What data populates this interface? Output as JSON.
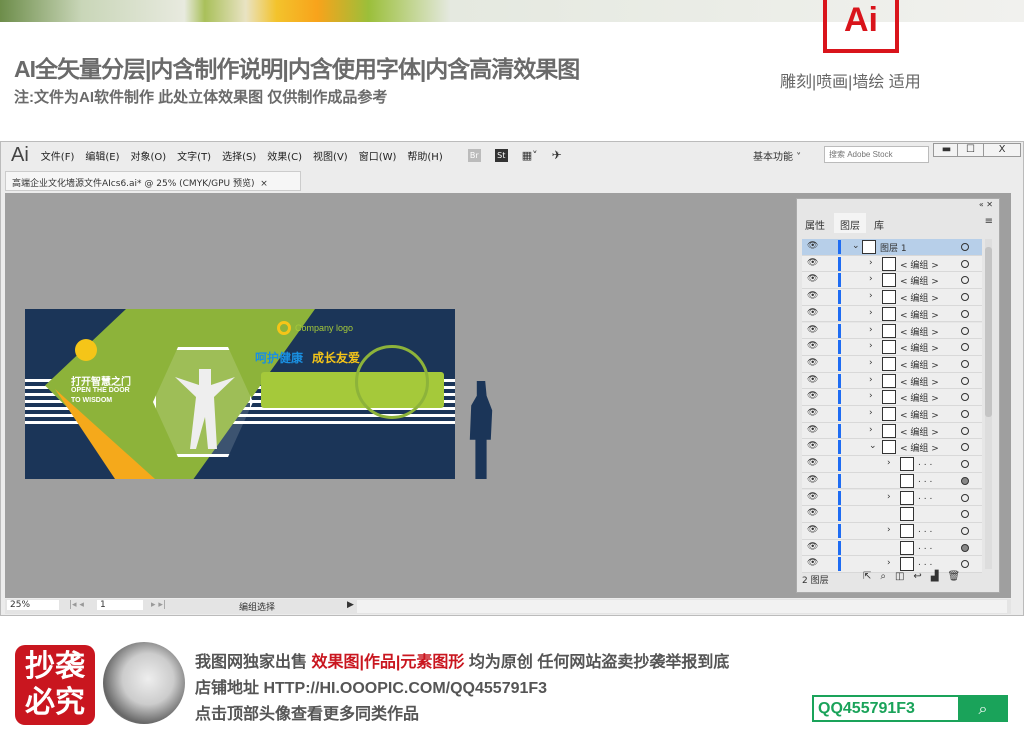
{
  "banner": {
    "logo": "Ai",
    "title": "AI全矢量分层|内含制作说明|内含使用字体|内含高清效果图",
    "subtitle": "注:文件为AI软件制作 此处立体效果图 仅供制作成品参考",
    "usage": "雕刻|喷画|墙绘 适用"
  },
  "app": {
    "logo": "Ai",
    "menus": [
      "文件(F)",
      "编辑(E)",
      "对象(O)",
      "文字(T)",
      "选择(S)",
      "效果(C)",
      "视图(V)",
      "窗口(W)",
      "帮助(H)"
    ],
    "bridge": "Br",
    "stock": "St",
    "workspace": "基本功能",
    "search_placeholder": "搜索 Adobe Stock",
    "min": "▬",
    "max": "☐",
    "close": "X"
  },
  "document_tab": {
    "title": "高端企业文化墙源文件AIcs6.ai* @ 25% (CMYK/GPU 预览)",
    "close": "×"
  },
  "artwork": {
    "slogan_cn": "打开智慧之门",
    "slogan_en1": "OPEN THE DOOR",
    "slogan_en2": "TO WISDOM",
    "logo_text": "Company logo",
    "heading1": "呵护健康",
    "heading2": "成长友爱",
    "colors": {
      "navy": "#1b3558",
      "green": "#8db33a",
      "yellow": "#f5c518"
    }
  },
  "layers_panel": {
    "tabs": [
      "属性",
      "图层",
      "库"
    ],
    "active_tab": "图层",
    "rows": [
      {
        "label": "图层 1",
        "chev": "v",
        "indent": 0,
        "selected": true
      },
      {
        "label": "< 编组 >",
        "chev": ">",
        "indent": 1
      },
      {
        "label": "< 编组 >",
        "chev": ">",
        "indent": 1
      },
      {
        "label": "< 编组 >",
        "chev": ">",
        "indent": 1
      },
      {
        "label": "< 编组 >",
        "chev": ">",
        "indent": 1
      },
      {
        "label": "< 编组 >",
        "chev": ">",
        "indent": 1
      },
      {
        "label": "< 编组 >",
        "chev": ">",
        "indent": 1
      },
      {
        "label": "< 编组 >",
        "chev": ">",
        "indent": 1
      },
      {
        "label": "< 编组 >",
        "chev": ">",
        "indent": 1
      },
      {
        "label": "< 编组 >",
        "chev": ">",
        "indent": 1
      },
      {
        "label": "< 编组 >",
        "chev": ">",
        "indent": 1
      },
      {
        "label": "< 编组 >",
        "chev": ">",
        "indent": 1
      },
      {
        "label": "< 编组 >",
        "chev": "v",
        "indent": 1
      },
      {
        "label": ". . .",
        "chev": ">",
        "indent": 2
      },
      {
        "label": ". . .",
        "chev": "",
        "indent": 2,
        "filled": true
      },
      {
        "label": ". . .",
        "chev": ">",
        "indent": 2
      },
      {
        "label": "",
        "chev": "",
        "indent": 2
      },
      {
        "label": ". . .",
        "chev": ">",
        "indent": 2
      },
      {
        "label": ". . .",
        "chev": "",
        "indent": 2,
        "filled": true
      },
      {
        "label": ". . .",
        "chev": ">",
        "indent": 2
      }
    ],
    "footer": "2 图层"
  },
  "statusbar": {
    "zoom": "25%",
    "artboard": "1",
    "tool": "编组选择"
  },
  "bottom": {
    "stamp": "抄袭必究",
    "line1_a": "我图网独家出售 ",
    "line1_b": "效果图|作品|元素图形",
    "line1_c": " 均为原创 任何网站盗卖抄袭举报到底",
    "line2": "店铺地址 HTTP://HI.OOOPIC.COM/QQ455791F3",
    "line3": "点击顶部头像查看更多同类作品",
    "search_value": "QQ455791F3"
  }
}
